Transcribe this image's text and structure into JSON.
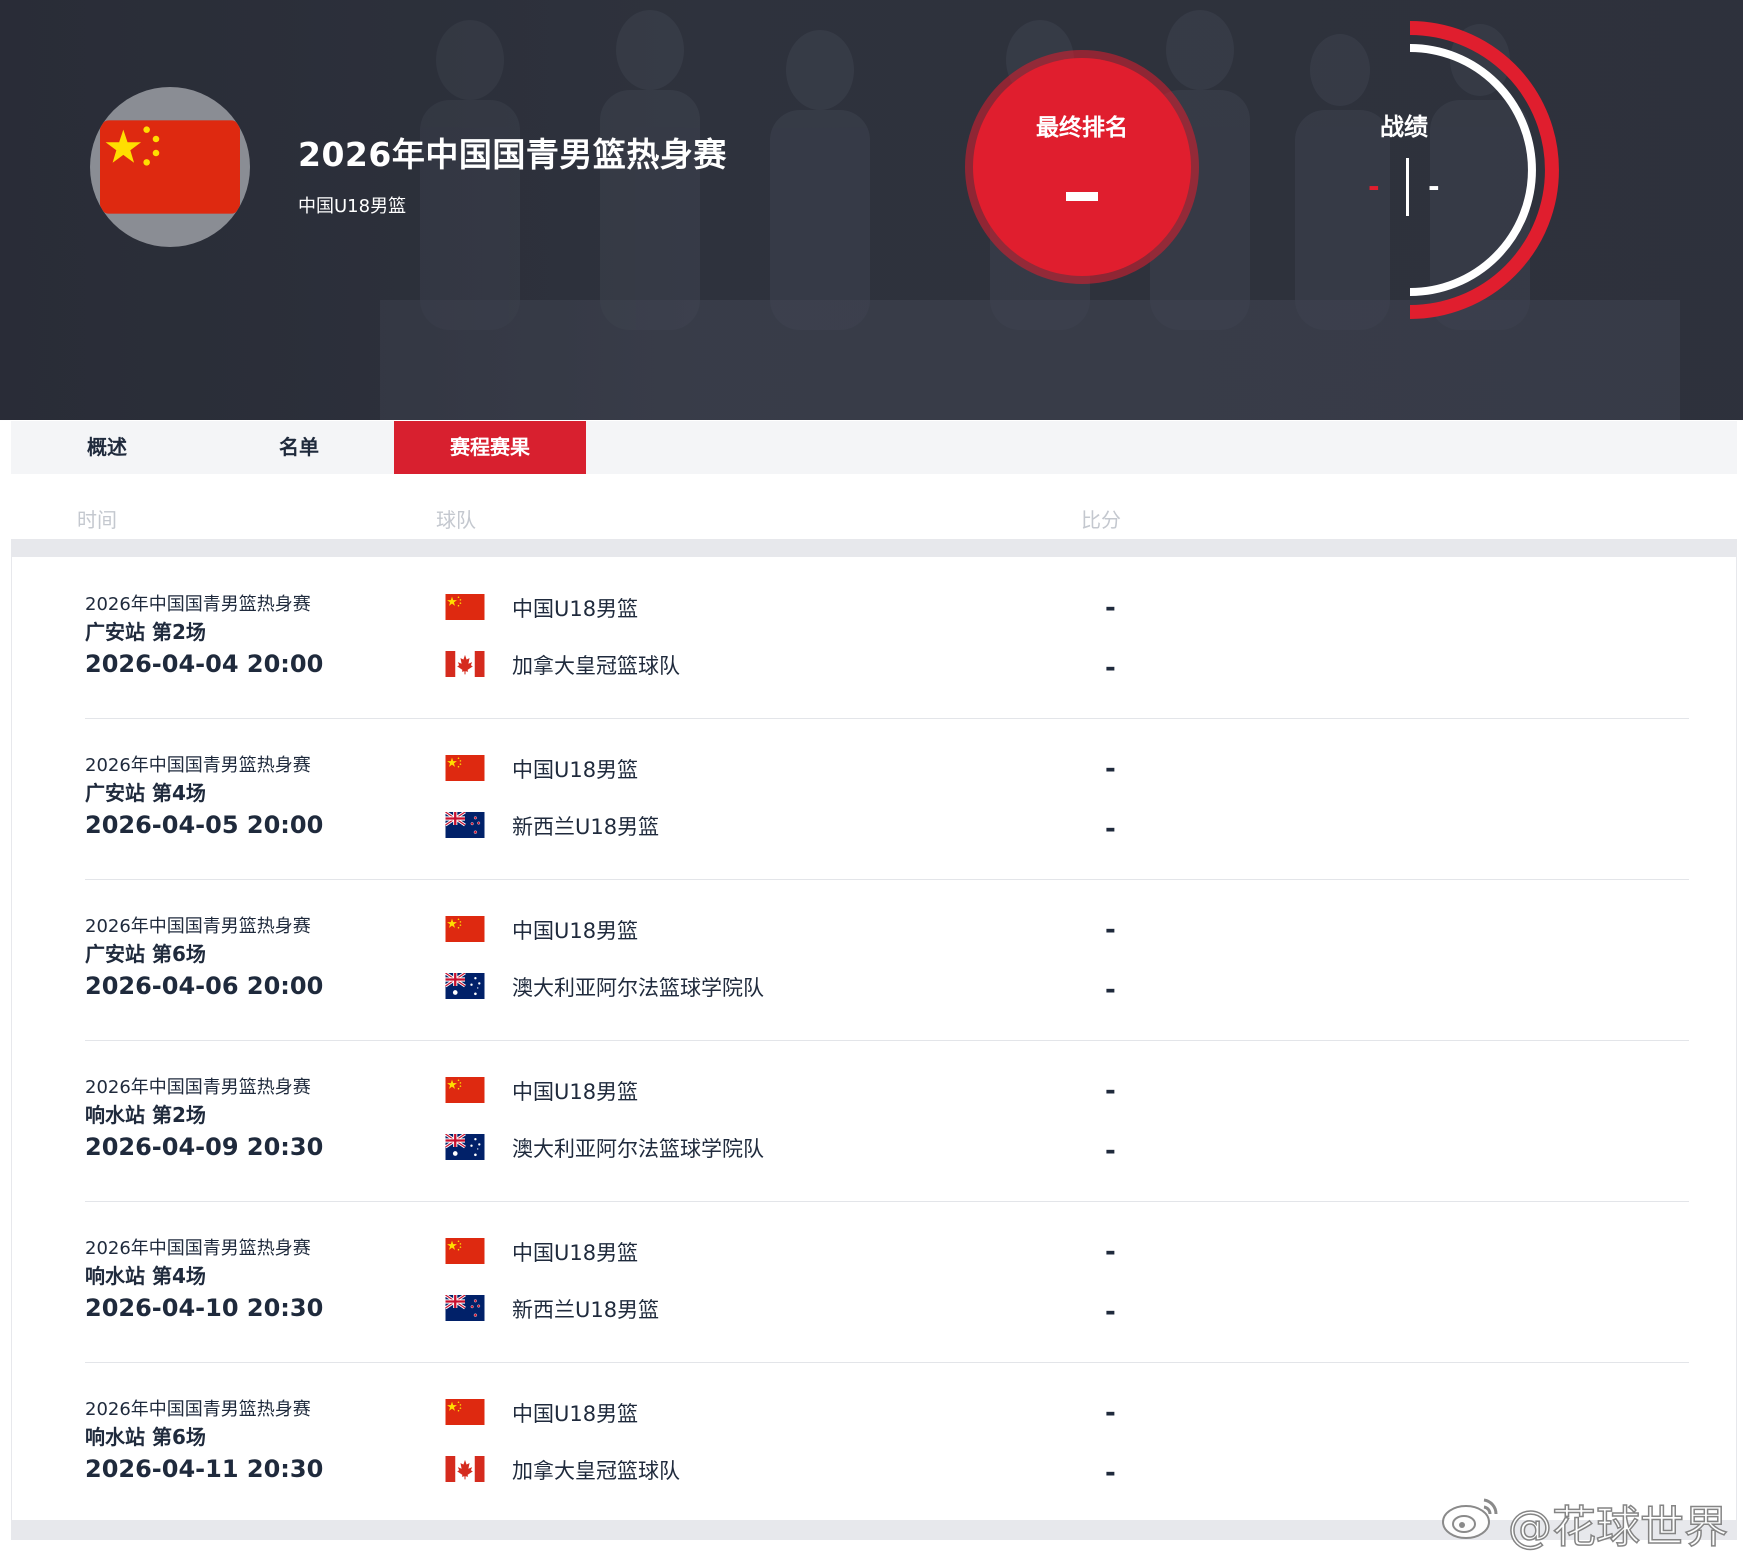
{
  "hero": {
    "title": "2026年中国国青男篮热身赛",
    "subtitle": "中国U18男篮",
    "rank_label": "最终排名",
    "rank_value": "-",
    "record_label": "战绩",
    "record_wins": "-",
    "record_losses": "-"
  },
  "colors": {
    "accent": "#d8202f",
    "hero_bg": "#2f333e",
    "text_dark": "#1f2a3c",
    "header_text": "#c4c8cf"
  },
  "tabs": [
    {
      "label": "概述",
      "active": false
    },
    {
      "label": "名单",
      "active": false
    },
    {
      "label": "赛程赛果",
      "active": true
    }
  ],
  "columns": {
    "time": "时间",
    "team": "球队",
    "score": "比分"
  },
  "matches": [
    {
      "competition": "2026年中国国青男篮热身赛",
      "round": "广安站 第2场",
      "datetime": "2026-04-04 20:00",
      "team1": {
        "name": "中国U18男篮",
        "flag": "china-flag-icon"
      },
      "team2": {
        "name": "加拿大皇冠篮球队",
        "flag": "canada-flag-icon"
      },
      "score1": "-",
      "score2": "-"
    },
    {
      "competition": "2026年中国国青男篮热身赛",
      "round": "广安站 第4场",
      "datetime": "2026-04-05 20:00",
      "team1": {
        "name": "中国U18男篮",
        "flag": "china-flag-icon"
      },
      "team2": {
        "name": "新西兰U18男篮",
        "flag": "new-zealand-flag-icon"
      },
      "score1": "-",
      "score2": "-"
    },
    {
      "competition": "2026年中国国青男篮热身赛",
      "round": "广安站 第6场",
      "datetime": "2026-04-06 20:00",
      "team1": {
        "name": "中国U18男篮",
        "flag": "china-flag-icon"
      },
      "team2": {
        "name": "澳大利亚阿尔法篮球学院队",
        "flag": "australia-flag-icon"
      },
      "score1": "-",
      "score2": "-"
    },
    {
      "competition": "2026年中国国青男篮热身赛",
      "round": "响水站 第2场",
      "datetime": "2026-04-09 20:30",
      "team1": {
        "name": "中国U18男篮",
        "flag": "china-flag-icon"
      },
      "team2": {
        "name": "澳大利亚阿尔法篮球学院队",
        "flag": "australia-flag-icon"
      },
      "score1": "-",
      "score2": "-"
    },
    {
      "competition": "2026年中国国青男篮热身赛",
      "round": "响水站 第4场",
      "datetime": "2026-04-10 20:30",
      "team1": {
        "name": "中国U18男篮",
        "flag": "china-flag-icon"
      },
      "team2": {
        "name": "新西兰U18男篮",
        "flag": "new-zealand-flag-icon"
      },
      "score1": "-",
      "score2": "-"
    },
    {
      "competition": "2026年中国国青男篮热身赛",
      "round": "响水站 第6场",
      "datetime": "2026-04-11 20:30",
      "team1": {
        "name": "中国U18男篮",
        "flag": "china-flag-icon"
      },
      "team2": {
        "name": "加拿大皇冠篮球队",
        "flag": "canada-flag-icon"
      },
      "score1": "-",
      "score2": "-"
    }
  ],
  "watermark": {
    "text": "@花球世界",
    "icon": "weibo-icon"
  }
}
